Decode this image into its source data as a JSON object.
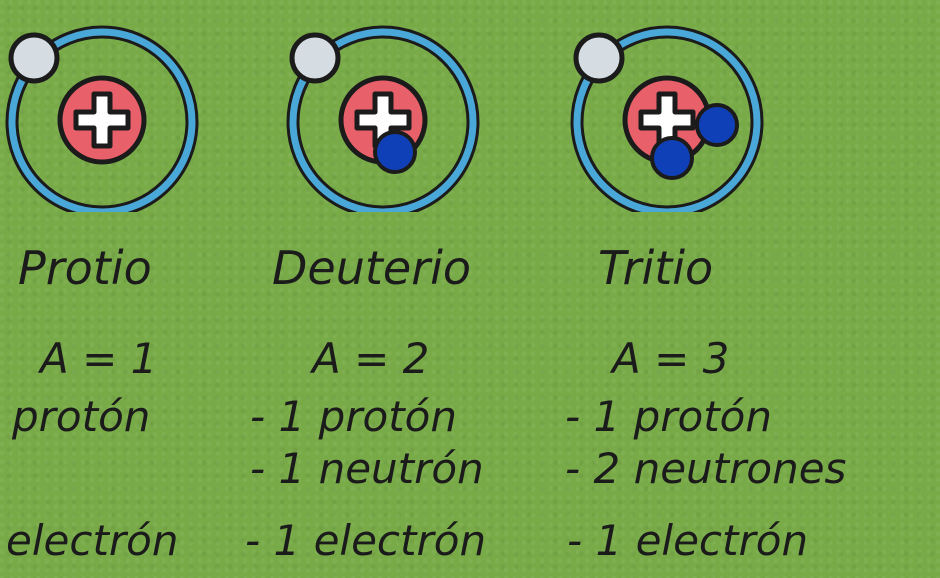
{
  "isotopes": [
    {
      "name": "Protio",
      "mass": "A = 1",
      "protons": "protón",
      "electrons": "electrón"
    },
    {
      "name": "Deuterio",
      "mass": "A = 2",
      "protons": "- 1 protón",
      "neutrons": "- 1 neutrón",
      "electrons": "- 1 electrón"
    },
    {
      "name": "Tritio",
      "mass": "A = 3",
      "protons": "- 1 protón",
      "neutrons": "- 2 neutrones",
      "electrons": "- 1 electrón"
    }
  ],
  "colors": {
    "background": "#78ab48",
    "orbit": "#4aa8d8",
    "nucleus": "#e8606a",
    "neutron": "#1040b8",
    "electron": "#d6dde2"
  }
}
